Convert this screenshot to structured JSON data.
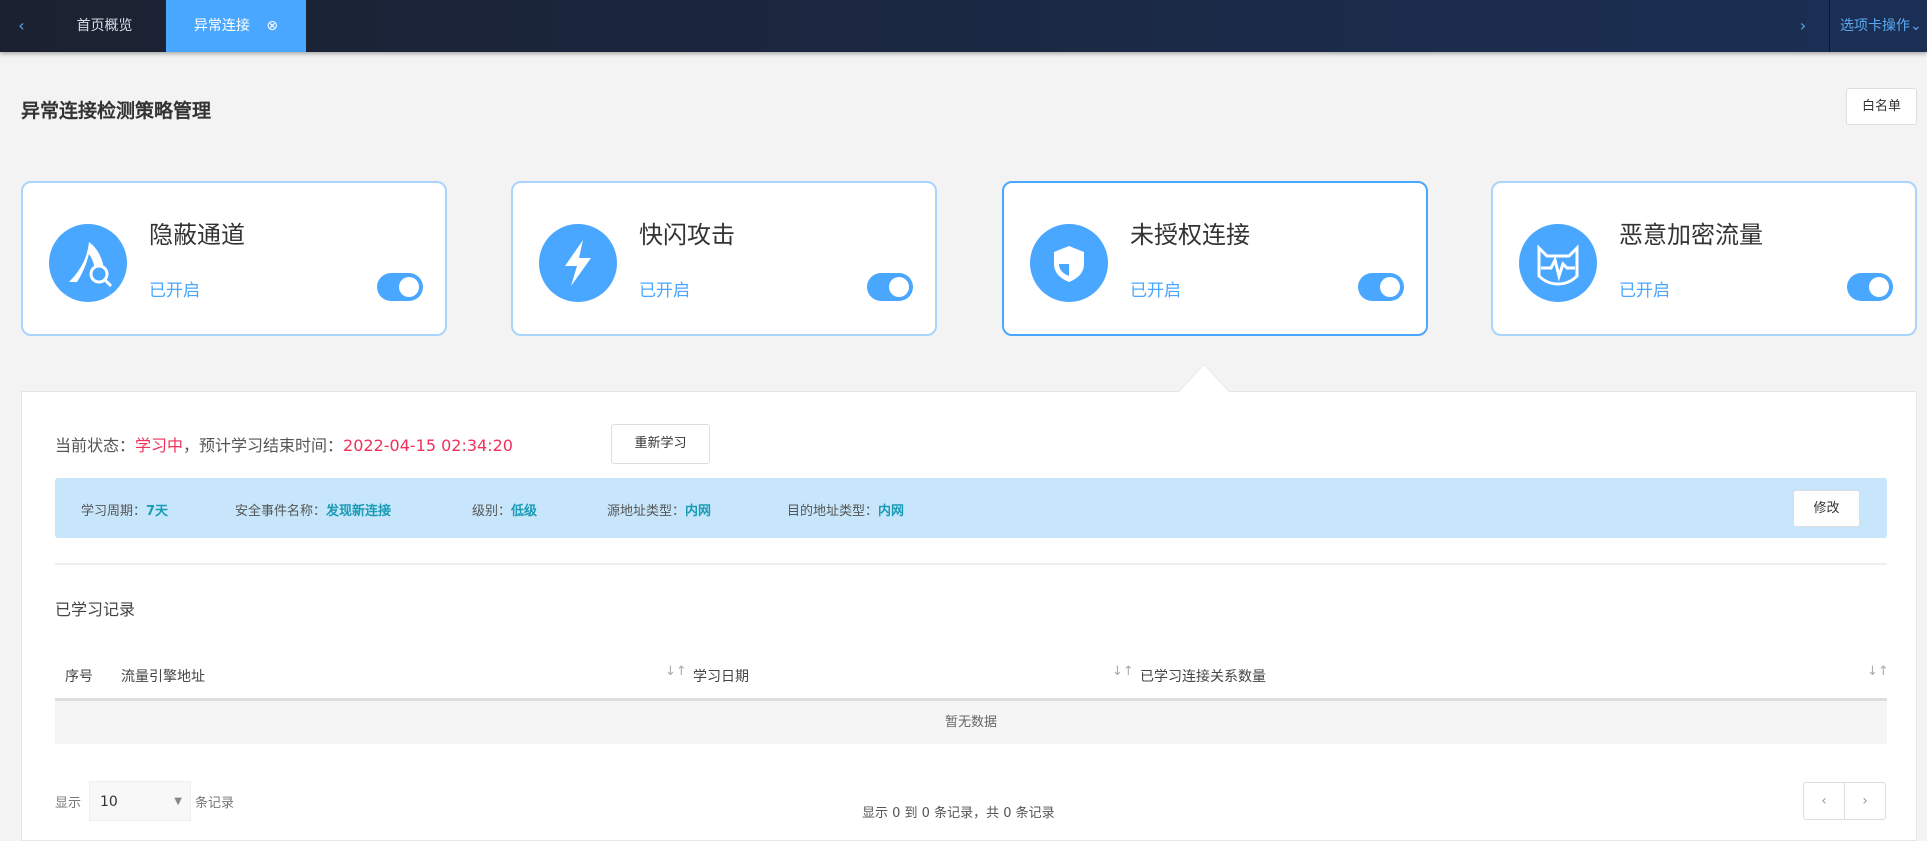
{
  "tabs": {
    "prev": "‹",
    "items": [
      {
        "label": "首页概览"
      },
      {
        "label": "异常连接",
        "close": "⊗"
      }
    ],
    "next": "›",
    "actions": "选项卡操作⌄"
  },
  "page": {
    "title": "异常连接检测策略管理",
    "whitelist_button": "白名单"
  },
  "cards": [
    {
      "name": "隐蔽通道",
      "status": "已开启",
      "icon": "tunnel-search-icon",
      "enabled": true
    },
    {
      "name": "快闪攻击",
      "status": "已开启",
      "icon": "lightning-icon",
      "enabled": true
    },
    {
      "name": "未授权连接",
      "status": "已开启",
      "icon": "shield-icon",
      "enabled": true
    },
    {
      "name": "恶意加密流量",
      "status": "已开启",
      "icon": "malicious-traffic-icon",
      "enabled": true
    }
  ],
  "detail": {
    "status_label": "当前状态：",
    "status_value": "学习中",
    "end_label": "，预计学习结束时间：",
    "end_value": "2022-04-15 02:34:20",
    "relearn_button": "重新学习",
    "info": [
      {
        "label": "学习周期：",
        "value": "7天"
      },
      {
        "label": "安全事件名称：",
        "value": "发现新连接"
      },
      {
        "label": "级别：",
        "value": "低级"
      },
      {
        "label": "源地址类型：",
        "value": "内网"
      },
      {
        "label": "目的地址类型：",
        "value": "内网"
      }
    ],
    "edit_button": "修改",
    "records_title": "已学习记录",
    "columns": [
      "序号",
      "流量引擎地址",
      "学习日期",
      "已学习连接关系数量"
    ],
    "empty_text": "暂无数据",
    "footer": {
      "show": "显示",
      "page_size": "10",
      "records": "条记录",
      "summary": "显示 0 到 0 条记录，共 0 条记录",
      "prev": "‹",
      "next": "›"
    }
  },
  "colors": {
    "accent": "#4aa7ff",
    "danger": "#f0305a",
    "info_bg": "#c7e6fb"
  }
}
